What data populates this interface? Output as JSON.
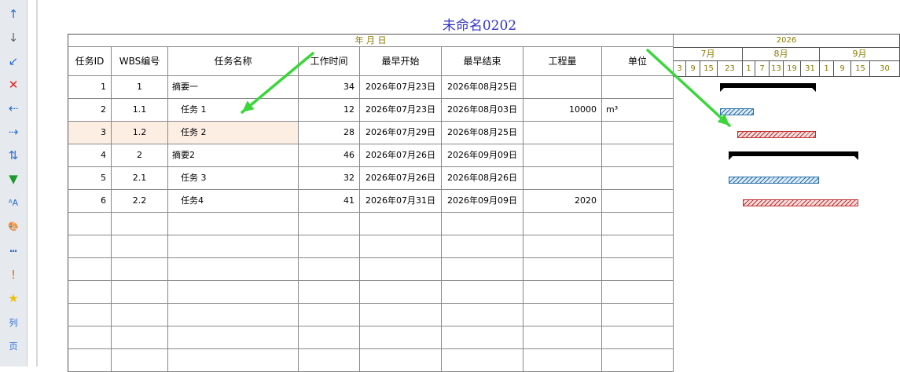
{
  "toolbar": {
    "items": [
      {
        "icon": "arrow-up-icon",
        "glyph": "↑",
        "color": "#2a6fd6"
      },
      {
        "icon": "arrow-down-icon",
        "glyph": "↓",
        "color": "#666666"
      },
      {
        "icon": "arrow-down-left-icon",
        "glyph": "↙",
        "color": "#2a6fd6"
      },
      {
        "icon": "delete-icon",
        "glyph": "✕",
        "color": "#e02020"
      },
      {
        "icon": "outdent-icon",
        "glyph": "⇠",
        "color": "#2a6fd6"
      },
      {
        "icon": "indent-icon",
        "glyph": "⇢",
        "color": "#2a6fd6"
      },
      {
        "icon": "swap-vertical-icon",
        "glyph": "⇅",
        "color": "#2a6fd6"
      },
      {
        "icon": "filter-icon",
        "glyph": "▼",
        "color": "#1a9a2a"
      },
      {
        "icon": "font-size-icon",
        "glyph": "ᴬA",
        "color": "#2a6fd6"
      },
      {
        "icon": "palette-icon",
        "glyph": "🎨",
        "color": "#d04040"
      },
      {
        "icon": "line-style-icon",
        "glyph": "┅",
        "color": "#2a6fd6"
      },
      {
        "icon": "exclamation-icon",
        "glyph": "!",
        "color": "#e07000"
      },
      {
        "icon": "star-icon",
        "glyph": "★",
        "color": "#f0c000"
      },
      {
        "icon": "column-icon",
        "glyph": "列",
        "color": "#2a6fd6"
      },
      {
        "icon": "page-icon",
        "glyph": "页",
        "color": "#2a6fd6"
      }
    ]
  },
  "document_title": "未命名0202",
  "table": {
    "date_header": "年 月 日",
    "columns": [
      "任务ID",
      "WBS编号",
      "任务名称",
      "工作时间",
      "最早开始",
      "最早结束",
      "工程量",
      "单位"
    ],
    "rows": [
      {
        "id": "1",
        "wbs": "1",
        "name": "摘要一",
        "duration": "34",
        "start": "2026年07月23日",
        "end": "2026年08月25日",
        "qty": "",
        "unit": ""
      },
      {
        "id": "2",
        "wbs": "1.1",
        "name": "任务 1",
        "duration": "12",
        "start": "2026年07月23日",
        "end": "2026年08月03日",
        "qty": "10000",
        "unit": "m³"
      },
      {
        "id": "3",
        "wbs": "1.2",
        "name": "任务 2",
        "duration": "28",
        "start": "2026年07月29日",
        "end": "2026年08月25日",
        "qty": "",
        "unit": ""
      },
      {
        "id": "4",
        "wbs": "2",
        "name": "摘要2",
        "duration": "46",
        "start": "2026年07月26日",
        "end": "2026年09月09日",
        "qty": "",
        "unit": ""
      },
      {
        "id": "5",
        "wbs": "2.1",
        "name": "任务 3",
        "duration": "32",
        "start": "2026年07月26日",
        "end": "2026年08月26日",
        "qty": "",
        "unit": ""
      },
      {
        "id": "6",
        "wbs": "2.2",
        "name": "任务4",
        "duration": "41",
        "start": "2026年07月31日",
        "end": "2026年09月09日",
        "qty": "2020",
        "unit": ""
      }
    ],
    "empty_rows": 7,
    "selected_row": 2,
    "selected_row_color": "#fdeee4"
  },
  "gantt": {
    "year": "2026",
    "months": [
      "7月",
      "8月",
      "9月"
    ],
    "days": [
      "3",
      "9",
      "15",
      "23",
      "1",
      "7",
      "13",
      "19",
      "31",
      "1",
      "9",
      "15",
      "30"
    ],
    "tasks": [
      {
        "kind": "summary",
        "start": "2026-07-23",
        "end": "2026-08-25"
      },
      {
        "kind": "blue",
        "start": "2026-07-23",
        "end": "2026-08-03"
      },
      {
        "kind": "red",
        "start": "2026-07-29",
        "end": "2026-08-25"
      },
      {
        "kind": "summary",
        "start": "2026-07-26",
        "end": "2026-09-09"
      },
      {
        "kind": "blue",
        "start": "2026-07-26",
        "end": "2026-08-26"
      },
      {
        "kind": "red",
        "start": "2026-07-31",
        "end": "2026-09-09"
      }
    ]
  },
  "colors": {
    "annotation_arrow": "#3ad63a",
    "title": "#3333cc",
    "timescale_text": "#8a7a00"
  }
}
